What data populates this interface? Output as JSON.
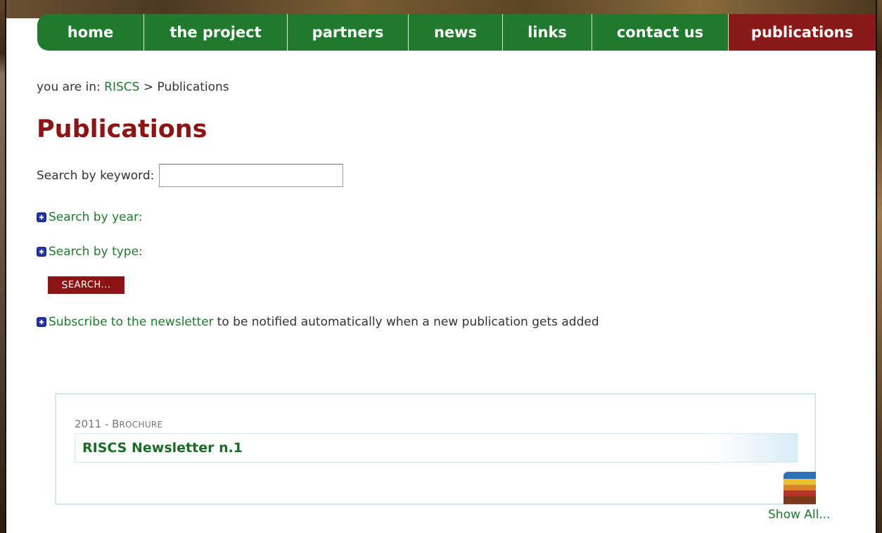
{
  "nav": {
    "items": [
      {
        "label": "home"
      },
      {
        "label": "the project"
      },
      {
        "label": "partners"
      },
      {
        "label": "news"
      },
      {
        "label": "links"
      },
      {
        "label": "contact us"
      },
      {
        "label": "publications"
      }
    ]
  },
  "breadcrumb": {
    "prefix": "you are in:",
    "root": "RISCS",
    "separator": ">",
    "current": "Publications"
  },
  "page": {
    "title": "Publications"
  },
  "search": {
    "keyword_label": "Search by keyword:",
    "keyword_value": "",
    "year_label": "Search by year:",
    "type_label": "Search by type:",
    "button_first": "S",
    "button_rest": "EARCH..."
  },
  "newsletter": {
    "link_text": "Subscribe to the newsletter",
    "rest_text": "to be notified automatically when a new publication gets added"
  },
  "publication": {
    "year": "2011",
    "sep": "-",
    "type_first": "B",
    "type_rest": "ROCHURE",
    "title": "RISCS Newsletter n.1"
  },
  "show_all": "Show All..."
}
